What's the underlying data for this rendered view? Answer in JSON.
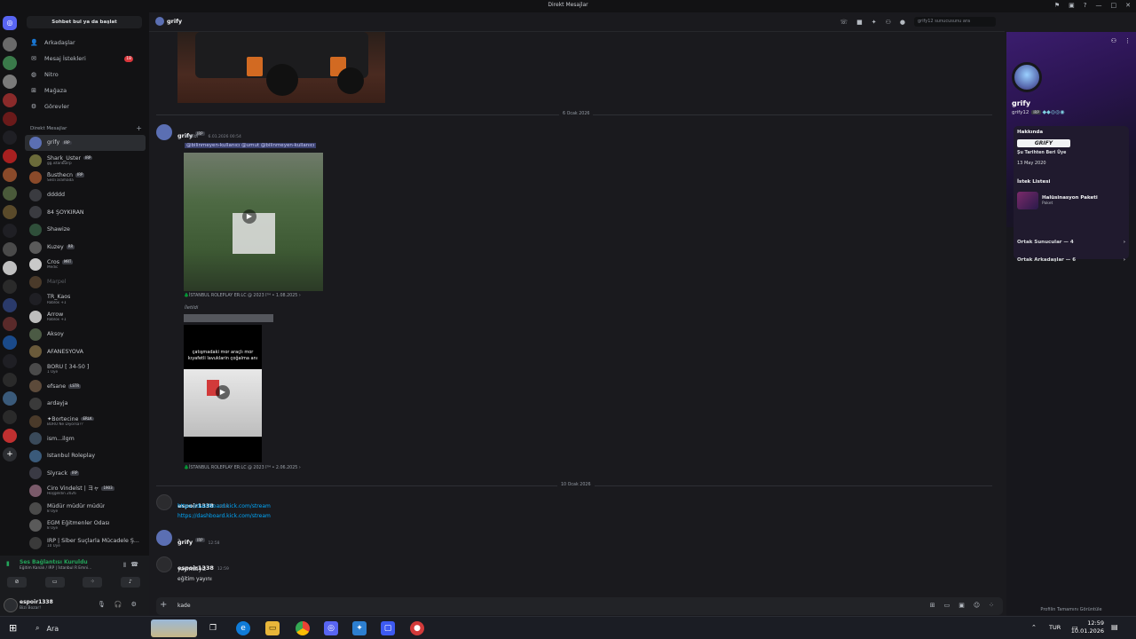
{
  "window": {
    "title": "Direkt Mesajlar"
  },
  "sidebar": {
    "search_label": "Sohbet bul ya da başlat",
    "nav": [
      {
        "label": "Arkadaşlar",
        "icon": "friends-icon"
      },
      {
        "label": "Mesaj İstekleri",
        "icon": "mail-icon",
        "badge": "18"
      },
      {
        "label": "Nitro",
        "icon": "nitro-icon"
      },
      {
        "label": "Mağaza",
        "icon": "shop-icon"
      },
      {
        "label": "Görevler",
        "icon": "quests-icon"
      }
    ],
    "dm_header": "Direkt Mesajlar",
    "dms": [
      {
        "name": "grify",
        "tag": "IRP",
        "sub": "",
        "color": "#5b6fb3"
      },
      {
        "name": "Shark_Uster",
        "tag": "IRP",
        "sub": "gg.istanbulrp",
        "color": "#6b6b3a"
      },
      {
        "name": "ßusthecn",
        "tag": "IRP",
        "sub": "Sesli aramada",
        "color": "#8a4a2a"
      },
      {
        "name": "ddddd",
        "tag": "",
        "sub": "",
        "color": "#3a3b40"
      },
      {
        "name": "84 ŞOYKIRAN",
        "tag": "",
        "sub": "",
        "color": "#3a3b40"
      },
      {
        "name": "Shawize",
        "tag": "",
        "sub": "",
        "color": "#2f4f3a"
      },
      {
        "name": "Kuzey",
        "tag": "RR",
        "sub": "",
        "color": "#5a5a5a"
      },
      {
        "name": "Cros",
        "tag": "MRT",
        "sub": "Medic",
        "color": "#c9c9c9"
      },
      {
        "name": "Marpel",
        "tag": "",
        "sub": "",
        "color": "#4a3a2a"
      },
      {
        "name": "TR_Kaos",
        "tag": "",
        "sub": "Roblox +1",
        "color": "#1f1f24"
      },
      {
        "name": "Arrow",
        "tag": "",
        "sub": "Roblox +1",
        "color": "#bdbdbd"
      },
      {
        "name": "Aksoy",
        "tag": "",
        "sub": "",
        "color": "#4b5a44"
      },
      {
        "name": "AFANESYOVA",
        "tag": "",
        "sub": "",
        "color": "#6a5a3a"
      },
      {
        "name": "BÖRÜ [ 34-50 ]",
        "tag": "",
        "sub": "1 Üye",
        "color": "#4a4a4a"
      },
      {
        "name": "efsane",
        "tag": "LSTR",
        "sub": "",
        "color": "#5c4a3a"
      },
      {
        "name": "ardayja",
        "tag": "",
        "sub": "",
        "color": "#3a3a3a"
      },
      {
        "name": "✦Bortecine",
        "tag": "ERLK",
        "sub": "BÖRÜ Ne Diyorsa??",
        "color": "#4a3a2a"
      },
      {
        "name": "ism...ilgm",
        "tag": "",
        "sub": "",
        "color": "#3a4a5a"
      },
      {
        "name": "İstanbul Roleplay",
        "tag": "",
        "sub": "",
        "color": "#3a5a7a"
      },
      {
        "name": "Slyrack",
        "tag": "IRP",
        "sub": "",
        "color": "#3a3a44"
      },
      {
        "name": "Ciro Vindelst | ヨャ",
        "tag": "1903",
        "sub": "Hoşgeldin 2026",
        "color": "#7a5a6a"
      },
      {
        "name": "Müdür müdür müdür",
        "tag": "",
        "sub": "8 Üye",
        "color": "#4a4a4a"
      },
      {
        "name": "EGM Eğitmenler Odası",
        "tag": "",
        "sub": "8 Üye",
        "color": "#5a5a5a"
      },
      {
        "name": "IRP | Siber Suçlarla Mücadele Ş...",
        "tag": "",
        "sub": "10 Üye",
        "color": "#3a3a3a"
      }
    ],
    "voice": {
      "status": "Ses Bağlantısı Kuruldu",
      "channel": "Eğitim Kanalı / IRP | İstanbul R Emni..."
    },
    "user": {
      "name": "espoir1338",
      "status": "Bizi Bozar!"
    }
  },
  "chat": {
    "recipient": "grify",
    "search_placeholder": "grify12 sunucusunu ara",
    "date1": "6 Ocak 2026",
    "date2": "10 Ocak 2026",
    "msg1": {
      "author": "grify",
      "tag": "IRP",
      "time": "6.01.2026 00:54",
      "forwarded": "İletildi",
      "mentions": "@bilinmeyen-kullanıcı  @umut  @bilinmeyen-kullanıcı",
      "source1": "🌲İSTANBUL ROLEPLAY ER:LC @ 2023 Iᵀᴹ • 1.08.2025 ›",
      "forwarded2": "İletildi",
      "video_caption": "çatışmadaki mor araçlı mor kıyafetli lavuklarin çoğalma anı",
      "source2": "🌲İSTANBUL ROLEPLAY ER:LC @ 2023 Iᵀᴹ • 2.06.2025 ›"
    },
    "msg2": {
      "author": "espoir1338",
      "time": "12:08",
      "links": [
        "https://dashboard.kick.com/stream",
        "https://dashboard.kick.com/stream"
      ]
    },
    "msg3": {
      "author": "grify",
      "tag": "IRP",
      "time": "12:58",
      "text": "?"
    },
    "msg4": {
      "author": "espoir1338",
      "time": "12:59",
      "lines": [
        "yayındayız",
        "eğitim yayını"
      ]
    },
    "composer_value": "kade"
  },
  "profile": {
    "display_name": "grify",
    "username": "grify12",
    "tag": "IRP",
    "about_title": "Hakkında",
    "about_badge": "GRIFY",
    "member_since_label": "Şu Tarihten Beri Üye",
    "member_since": "13 May 2020",
    "wishlist_title": "İstek Listesi",
    "wishlist_item": "Halüsinasyon Paketi",
    "wishlist_sub": "Paket",
    "mutual_servers": "Ortak Sunucular — 4",
    "mutual_friends": "Ortak Arkadaşlar — 6",
    "view_full": "Profilin Tamamını Görüntüle"
  },
  "taskbar": {
    "search": "Ara",
    "lang": "TUR",
    "time": "12:59",
    "date": "10.01.2026"
  }
}
